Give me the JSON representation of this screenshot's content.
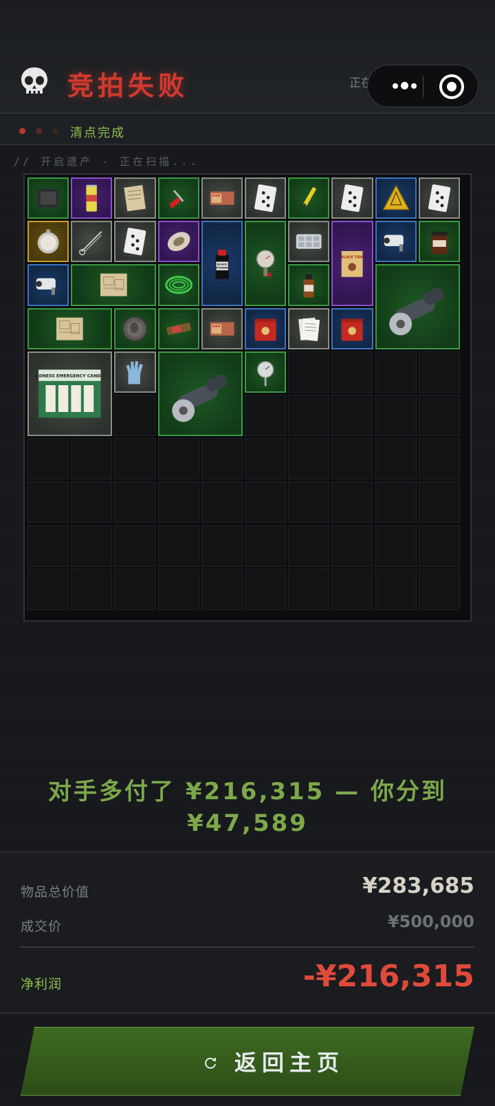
{
  "header": {
    "title": "竞拍失败",
    "restoring_text": "正在还原遗产情...",
    "skull_icon": "skull-icon"
  },
  "mini_program_capsule": {
    "more_icon": "more-dots-icon",
    "close_icon": "target-circle-icon"
  },
  "steps": {
    "label": "清点完成",
    "dot_colors": [
      "#c0392b",
      "#5a2a27",
      "#3a2422"
    ]
  },
  "scan_text": "//  开启遗产 - 正在扫描...",
  "inventory": {
    "columns": 10,
    "rows": 10,
    "items": [
      {
        "name": "sealed-pouch",
        "rarity": "green",
        "icon": "pouch-icon"
      },
      {
        "name": "energy-drink-can",
        "rarity": "purple",
        "icon": "can-icon"
      },
      {
        "name": "paper-note",
        "rarity": "gray",
        "icon": "paper-icon"
      },
      {
        "name": "screwdriver",
        "rarity": "green",
        "icon": "screwdriver-icon"
      },
      {
        "name": "matchbox",
        "rarity": "gray",
        "icon": "matchbox-icon"
      },
      {
        "name": "playing-card",
        "rarity": "gray",
        "icon": "card-icon"
      },
      {
        "name": "soldering-pen",
        "rarity": "green",
        "icon": "pen-icon"
      },
      {
        "name": "playing-card",
        "rarity": "gray",
        "icon": "card-icon"
      },
      {
        "name": "warning-sign",
        "rarity": "blue",
        "icon": "warning-triangle-icon"
      },
      {
        "name": "playing-card",
        "rarity": "gray",
        "icon": "card-icon"
      },
      {
        "name": "pocket-watch",
        "rarity": "gold",
        "icon": "watch-icon"
      },
      {
        "name": "scissors",
        "rarity": "gray",
        "icon": "scissors-icon"
      },
      {
        "name": "playing-card",
        "rarity": "gray",
        "icon": "card-icon"
      },
      {
        "name": "ornate-egg",
        "rarity": "purple",
        "icon": "egg-icon"
      },
      {
        "name": "black-powder-bottle",
        "rarity": "blue",
        "icon": "bottle-icon",
        "label": "BLACK POWDER"
      },
      {
        "name": "pressure-gauge",
        "rarity": "green",
        "icon": "gauge-icon"
      },
      {
        "name": "pill-tray",
        "rarity": "gray",
        "icon": "tray-icon"
      },
      {
        "name": "black-tide-book",
        "rarity": "purple",
        "icon": "book-icon",
        "label": "BLACK TIDE"
      },
      {
        "name": "security-camera",
        "rarity": "blue",
        "icon": "camera-icon"
      },
      {
        "name": "coffee-jar",
        "rarity": "green",
        "icon": "jar-icon"
      },
      {
        "name": "security-camera",
        "rarity": "blue",
        "icon": "camera-icon"
      },
      {
        "name": "blueprint-map",
        "rarity": "green",
        "icon": "map-icon"
      },
      {
        "name": "wire-coil",
        "rarity": "green",
        "icon": "coil-icon"
      },
      {
        "name": "medicine-bottle",
        "rarity": "green",
        "icon": "medicine-icon"
      },
      {
        "name": "angle-grinder",
        "rarity": "green",
        "icon": "grinder-icon"
      },
      {
        "name": "blueprint-map",
        "rarity": "green",
        "icon": "map-icon"
      },
      {
        "name": "old-coin",
        "rarity": "green",
        "icon": "coin-icon"
      },
      {
        "name": "snack-bar",
        "rarity": "green",
        "icon": "bar-icon"
      },
      {
        "name": "matchbox",
        "rarity": "gray",
        "icon": "matchbox-icon"
      },
      {
        "name": "red-tin",
        "rarity": "blue",
        "icon": "tin-icon"
      },
      {
        "name": "paper-stack",
        "rarity": "gray",
        "icon": "papers-icon"
      },
      {
        "name": "red-tin",
        "rarity": "blue",
        "icon": "tin-icon"
      },
      {
        "name": "emergency-candles",
        "rarity": "gray",
        "icon": "candles-icon",
        "label": "WILDNESS EMERGENCY CANDLES"
      },
      {
        "name": "rubber-glove",
        "rarity": "gray",
        "icon": "glove-icon"
      },
      {
        "name": "angle-grinder",
        "rarity": "green",
        "icon": "grinder-icon"
      },
      {
        "name": "thermometer",
        "rarity": "green",
        "icon": "thermometer-icon"
      }
    ]
  },
  "result_message": "对手多付了 ¥216,315 — 你分到 ¥47,589",
  "summary": {
    "total_value_label": "物品总价值",
    "total_value": "¥283,685",
    "deal_price_label": "成交价",
    "deal_price": "¥500,000",
    "net_profit_label": "净利润",
    "net_profit": "-¥216,315",
    "colors": {
      "profit_negative": "#e04a3a",
      "label_green": "#8fbf4e"
    }
  },
  "home_button": {
    "label": "返回主页",
    "icon": "refresh-icon"
  }
}
